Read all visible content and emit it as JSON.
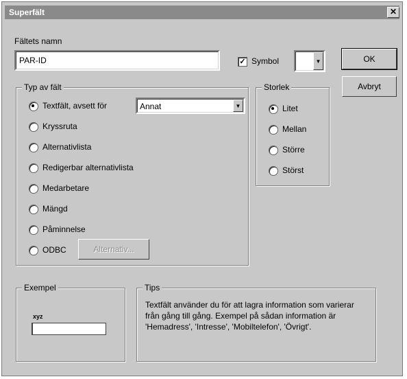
{
  "window": {
    "title": "Superfält",
    "close": "✕"
  },
  "field_name": {
    "label": "Fältets namn",
    "value": "PAR-ID"
  },
  "symbol": {
    "label": "Symbol",
    "checked": true,
    "value": ""
  },
  "buttons": {
    "ok": "OK",
    "cancel": "Avbryt",
    "alternatives": "Alternativ..."
  },
  "type_group": {
    "title": "Typ av fält",
    "options": [
      {
        "label": "Textfält, avsett för",
        "selected": true
      },
      {
        "label": "Kryssruta",
        "selected": false
      },
      {
        "label": "Alternativlista",
        "selected": false
      },
      {
        "label": "Redigerbar alternativlista",
        "selected": false
      },
      {
        "label": "Medarbetare",
        "selected": false
      },
      {
        "label": "Mängd",
        "selected": false
      },
      {
        "label": "Påminnelse",
        "selected": false
      },
      {
        "label": "ODBC",
        "selected": false
      }
    ],
    "text_purpose_value": "Annat"
  },
  "size_group": {
    "title": "Storlek",
    "options": [
      {
        "label": "Litet",
        "selected": true
      },
      {
        "label": "Mellan",
        "selected": false
      },
      {
        "label": "Större",
        "selected": false
      },
      {
        "label": "Störst",
        "selected": false
      }
    ]
  },
  "example_group": {
    "title": "Exempel",
    "sample_label": "xyz"
  },
  "tips_group": {
    "title": "Tips",
    "text": "Textfält använder du för att lagra information som varierar från gång till gång. Exempel på sådan information är 'Hemadress', 'Intresse', 'Mobiltelefon', 'Övrigt'."
  }
}
